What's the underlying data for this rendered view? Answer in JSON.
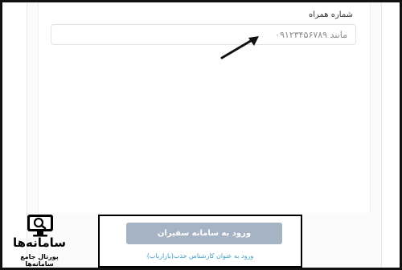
{
  "form": {
    "phone_label": "شماره همراه",
    "phone_placeholder": "مانند ۰۹۱۲۳۴۵۶۷۸۹"
  },
  "actions": {
    "login_button": "ورود به سامانه سفیران",
    "expert_link": "ورود به عنوان کارشناس جذب(بازاریاب)"
  },
  "logo": {
    "title": "سامانه‌ها",
    "subtitle": "پورتال جامع سامانه‌ها"
  },
  "colors": {
    "button_bg": "#a6b3c4",
    "link": "#3aa0c4",
    "highlight_border": "#000000"
  }
}
